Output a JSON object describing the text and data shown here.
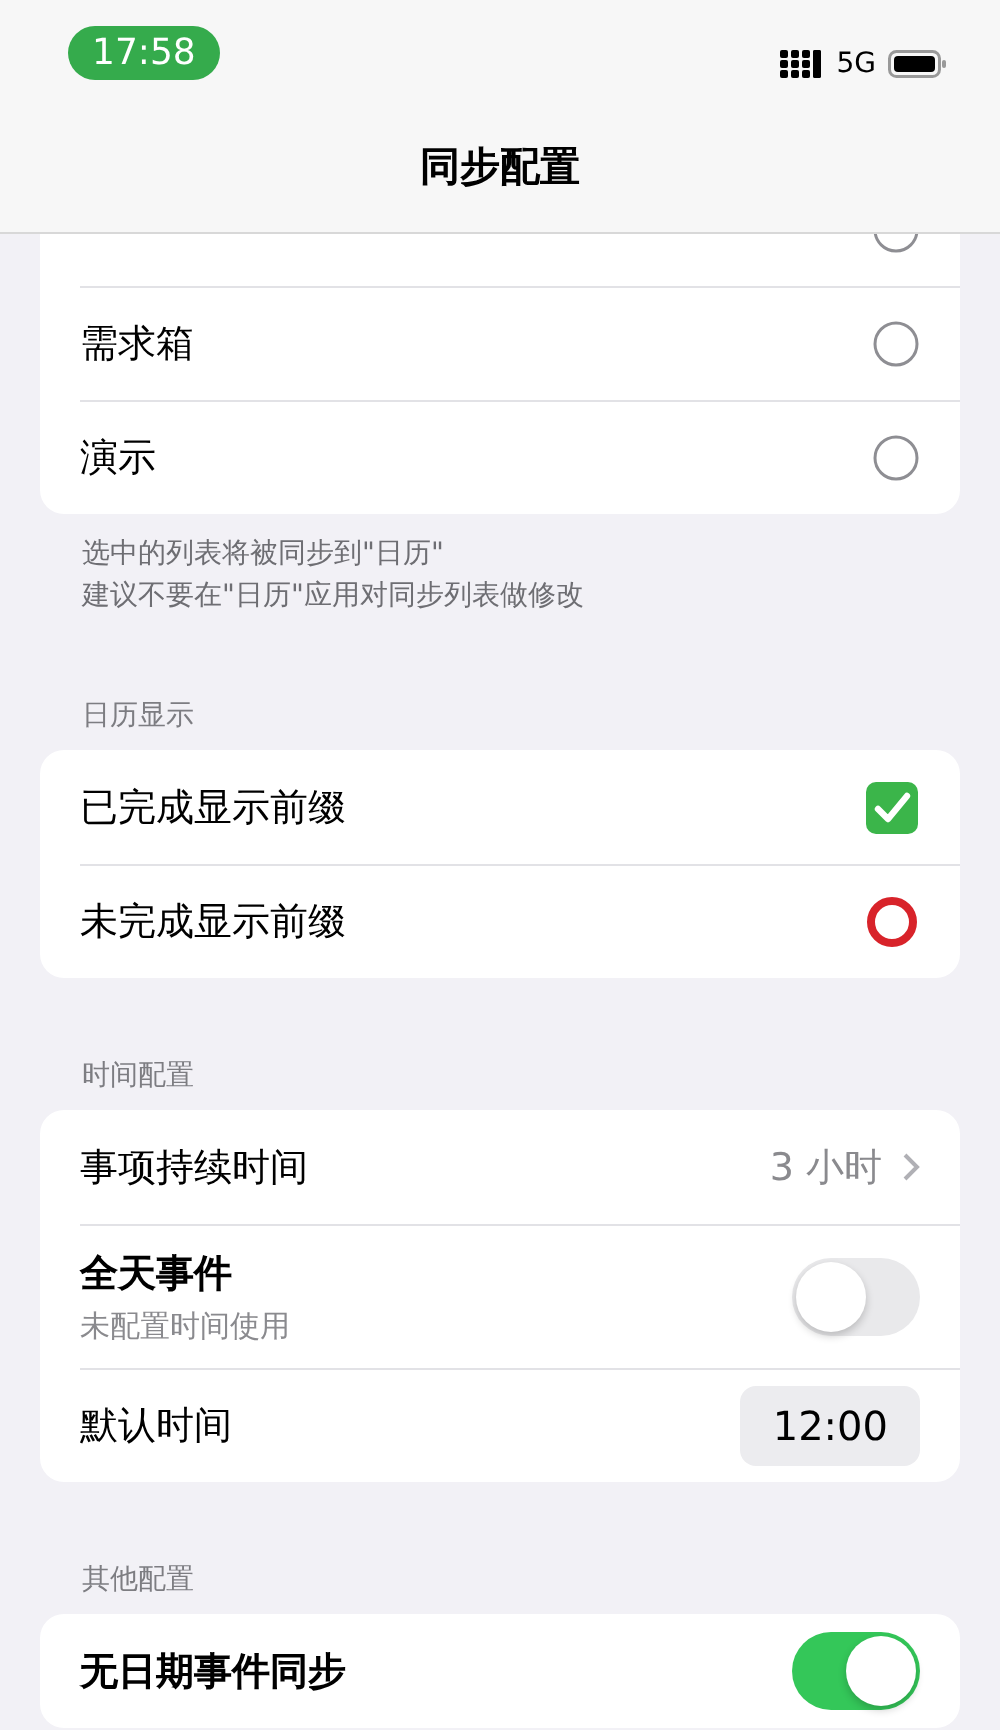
{
  "status_bar": {
    "time": "17:58",
    "network": "5G"
  },
  "nav": {
    "title": "同步配置"
  },
  "lists_card": {
    "items": [
      {
        "selected": false
      },
      {
        "label": "需求箱",
        "selected": false
      },
      {
        "label": "演示",
        "selected": false
      }
    ],
    "footer": [
      "选中的列表将被同步到\"日历\"",
      "建议不要在\"日历\"应用对同步列表做修改"
    ]
  },
  "display_section": {
    "header": "日历显示",
    "items": [
      {
        "label": "已完成显示前缀",
        "kind": "check"
      },
      {
        "label": "未完成显示前缀",
        "kind": "circle"
      }
    ]
  },
  "time_section": {
    "header": "时间配置",
    "rows": [
      {
        "kind": "value",
        "label": "事项持续时间",
        "value": "3 小时"
      },
      {
        "kind": "toggle",
        "label": "全天事件",
        "subtitle": "未配置时间使用",
        "on": false
      },
      {
        "kind": "time",
        "label": "默认时间",
        "value": "12:00"
      }
    ]
  },
  "other_section": {
    "header": "其他配置",
    "rows": [
      {
        "kind": "toggle",
        "label": "无日期事件同步",
        "on": true
      }
    ]
  }
}
